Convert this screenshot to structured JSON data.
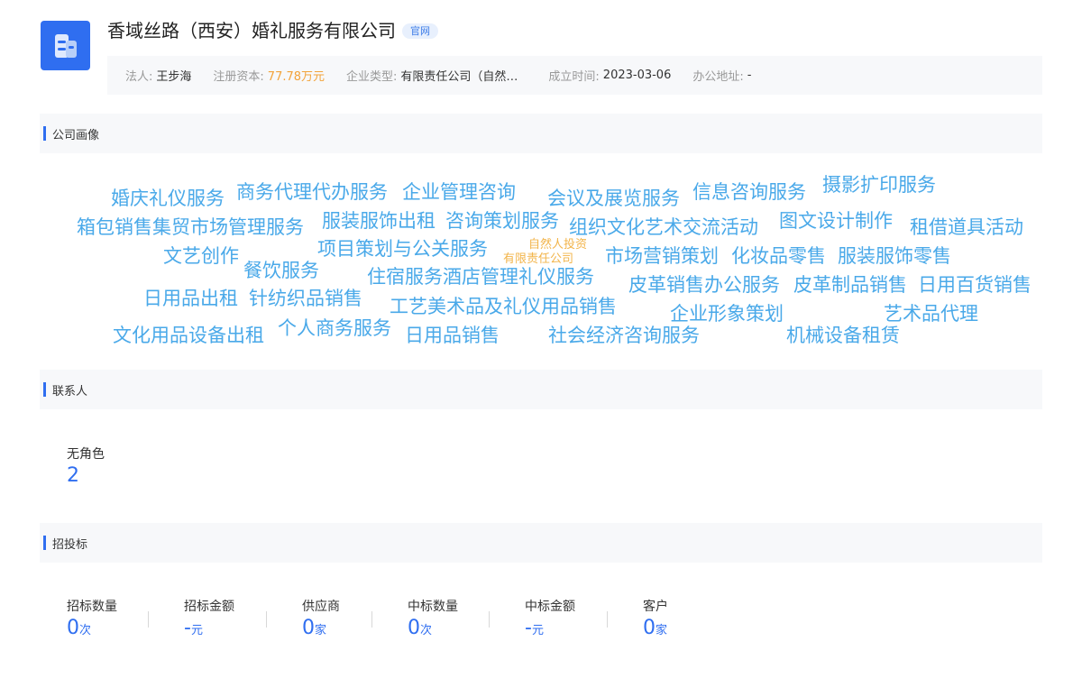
{
  "company": {
    "name": "香域丝路（西安）婚礼服务有限公司",
    "official_badge": "官网",
    "logo_icon": "building-icon",
    "colors": {
      "primary": "#2f6ef0",
      "orange": "#f2a33a",
      "cloud_blue": "#4aa9e9"
    }
  },
  "info": {
    "legal_person_label": "法人:",
    "legal_person": "王步海",
    "capital_label": "注册资本:",
    "capital": "77.78万元",
    "type_label": "企业类型:",
    "type": "有限责任公司（自然人投资或控股）",
    "founded_label": "成立时间:",
    "founded": "2023-03-06",
    "address_label": "办公地址:",
    "address": "-"
  },
  "portrait": {
    "title": "公司画像",
    "words": [
      "婚庆礼仪服务",
      "商务代理代办服务",
      "企业管理咨询",
      "会议及展览服务",
      "信息咨询服务",
      "摄影扩印服务",
      "箱包销售集贸市场管理服务",
      "服装服饰出租",
      "咨询策划服务",
      "组织文化艺术交流活动",
      "图文设计制作",
      "租借道具活动",
      "文艺创作",
      "项目策划与公关服务",
      "自然人投资",
      "有限责任公司",
      "市场营销策划",
      "化妆品零售",
      "服装服饰零售",
      "餐饮服务",
      "住宿服务酒店管理礼仪服务",
      "皮革销售办公服务",
      "皮革制品销售",
      "日用百货销售",
      "日用品出租",
      "针纺织品销售",
      "工艺美术品及礼仪用品销售",
      "企业形象策划",
      "艺术品代理",
      "文化用品设备出租",
      "个人商务服务",
      "日用品销售",
      "社会经济咨询服务",
      "机械设备租赁"
    ]
  },
  "contacts": {
    "title": "联系人",
    "role_label": "无角色",
    "role_count": "2"
  },
  "bidding": {
    "title": "招投标",
    "stats": [
      {
        "label": "招标数量",
        "value": "0",
        "unit": "次"
      },
      {
        "label": "招标金额",
        "value": "-",
        "unit": "元"
      },
      {
        "label": "供应商",
        "value": "0",
        "unit": "家"
      },
      {
        "label": "中标数量",
        "value": "0",
        "unit": "次"
      },
      {
        "label": "中标金额",
        "value": "-",
        "unit": "元"
      },
      {
        "label": "客户",
        "value": "0",
        "unit": "家"
      }
    ]
  }
}
